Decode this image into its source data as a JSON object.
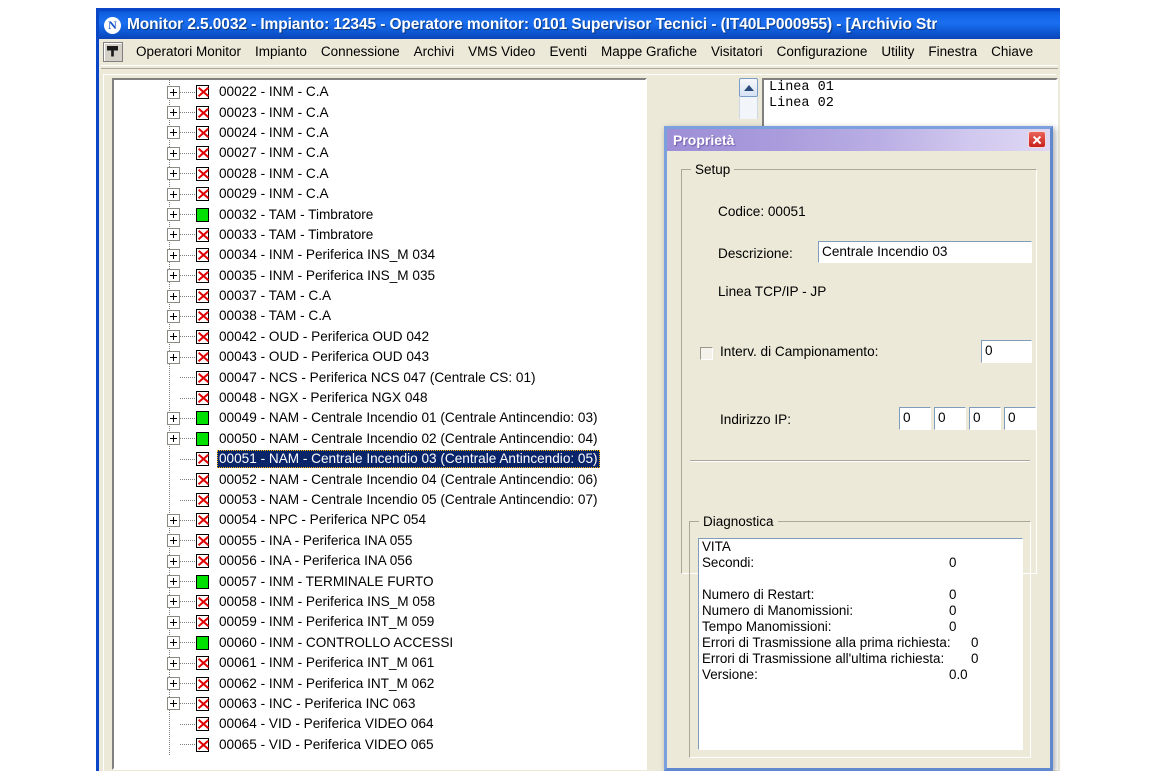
{
  "window": {
    "title": "Monitor 2.5.0032 - Impianto: 12345 - Operatore monitor: 0101 Supervisor Tecnici - (IT40LP000955) - [Archivio Str",
    "title_icon": "N",
    "system_icon_name": "application-system-icon"
  },
  "menu": {
    "items": [
      "Operatori Monitor",
      "Impianto",
      "Connessione",
      "Archivi",
      "VMS Video",
      "Eventi",
      "Mappe Grafiche",
      "Visitatori",
      "Configurazione",
      "Utility",
      "Finestra",
      "Chiave"
    ]
  },
  "tree": {
    "nodes": [
      {
        "expander": true,
        "icon": "error-x-icon",
        "label": "00022 - INM - C.A",
        "selected": false
      },
      {
        "expander": true,
        "icon": "error-x-icon",
        "label": "00023 - INM - C.A",
        "selected": false
      },
      {
        "expander": true,
        "icon": "error-x-icon",
        "label": "00024 - INM - C.A",
        "selected": false
      },
      {
        "expander": true,
        "icon": "error-x-icon",
        "label": "00027 - INM - C.A",
        "selected": false
      },
      {
        "expander": true,
        "icon": "error-x-icon",
        "label": "00028 - INM - C.A",
        "selected": false
      },
      {
        "expander": true,
        "icon": "error-x-icon",
        "label": "00029 - INM - C.A",
        "selected": false
      },
      {
        "expander": true,
        "icon": "ok-green-icon",
        "label": "00032 - TAM - Timbratore",
        "selected": false
      },
      {
        "expander": true,
        "icon": "error-x-icon",
        "label": "00033 - TAM - Timbratore",
        "selected": false
      },
      {
        "expander": true,
        "icon": "error-x-icon",
        "label": "00034 - INM - Periferica INS_M 034",
        "selected": false
      },
      {
        "expander": true,
        "icon": "error-x-icon",
        "label": "00035 - INM - Periferica INS_M 035",
        "selected": false
      },
      {
        "expander": true,
        "icon": "error-x-icon",
        "label": "00037 - TAM - C.A",
        "selected": false
      },
      {
        "expander": true,
        "icon": "error-x-icon",
        "label": "00038 - TAM - C.A",
        "selected": false
      },
      {
        "expander": true,
        "icon": "error-x-icon",
        "label": "00042 - OUD - Periferica OUD 042",
        "selected": false
      },
      {
        "expander": true,
        "icon": "error-x-icon",
        "label": "00043 - OUD - Periferica OUD 043",
        "selected": false
      },
      {
        "expander": false,
        "icon": "error-x-icon",
        "label": "00047 - NCS - Periferica NCS 047 (Centrale CS: 01)",
        "selected": false
      },
      {
        "expander": false,
        "icon": "error-x-icon",
        "label": "00048 - NGX - Periferica NGX 048",
        "selected": false
      },
      {
        "expander": true,
        "icon": "ok-green-icon",
        "label": "00049 - NAM - Centrale Incendio 01 (Centrale Antincendio: 03)",
        "selected": false
      },
      {
        "expander": true,
        "icon": "ok-green-icon",
        "label": "00050 - NAM - Centrale Incendio 02 (Centrale Antincendio: 04)",
        "selected": false
      },
      {
        "expander": false,
        "icon": "error-x-icon",
        "label": "00051 - NAM - Centrale Incendio 03 (Centrale Antincendio: 05)",
        "selected": true
      },
      {
        "expander": false,
        "icon": "error-x-icon",
        "label": "00052 - NAM - Centrale Incendio 04 (Centrale Antincendio: 06)",
        "selected": false
      },
      {
        "expander": false,
        "icon": "error-x-icon",
        "label": "00053 - NAM - Centrale Incendio 05 (Centrale Antincendio: 07)",
        "selected": false
      },
      {
        "expander": true,
        "icon": "error-x-icon",
        "label": "00054 - NPC - Periferica NPC 054",
        "selected": false
      },
      {
        "expander": true,
        "icon": "error-x-icon",
        "label": "00055 - INA - Periferica INA 055",
        "selected": false
      },
      {
        "expander": true,
        "icon": "error-x-icon",
        "label": "00056 - INA - Periferica INA 056",
        "selected": false
      },
      {
        "expander": true,
        "icon": "ok-green-icon",
        "label": "00057 - INM - TERMINALE FURTO",
        "selected": false
      },
      {
        "expander": true,
        "icon": "error-x-icon",
        "label": "00058 - INM - Periferica INS_M 058",
        "selected": false
      },
      {
        "expander": true,
        "icon": "error-x-icon",
        "label": "00059 - INM - Periferica INT_M 059",
        "selected": false
      },
      {
        "expander": true,
        "icon": "ok-green-icon",
        "label": "00060 - INM - CONTROLLO ACCESSI",
        "selected": false
      },
      {
        "expander": true,
        "icon": "error-x-icon",
        "label": "00061 - INM - Periferica INT_M 061",
        "selected": false
      },
      {
        "expander": true,
        "icon": "error-x-icon",
        "label": "00062 - INM - Periferica INT_M 062",
        "selected": false
      },
      {
        "expander": true,
        "icon": "error-x-icon",
        "label": "00063 - INC - Periferica INC 063",
        "selected": false
      },
      {
        "expander": false,
        "icon": "error-x-icon",
        "label": "00064 - VID - Periferica VIDEO 064",
        "selected": false
      },
      {
        "expander": false,
        "icon": "error-x-icon",
        "label": "00065 - VID - Periferica VIDEO 065",
        "selected": false
      }
    ]
  },
  "lines_panel": {
    "lines": [
      "Linea 01",
      "Linea 02"
    ]
  },
  "dialog": {
    "title": "Proprietà",
    "close_label": "x",
    "setup": {
      "legend": "Setup",
      "codice_label": "Codice: 00051",
      "descrizione_label": "Descrizione:",
      "descrizione_value": "Centrale Incendio 03",
      "linea_label": "Linea TCP/IP - JP",
      "interv_label": "Interv. di Campionamento:",
      "interv_value": "0",
      "interv_checked": false,
      "ip_label": "Indirizzo IP:",
      "ip_octets": [
        "0",
        "0",
        "0",
        "0"
      ]
    },
    "diagnostica": {
      "legend": "Diagnostica",
      "rows": [
        {
          "label": "VITA",
          "value": ""
        },
        {
          "label": "Secondi:",
          "value": "0"
        },
        {
          "label": "",
          "value": ""
        },
        {
          "label": "Numero di Restart:",
          "value": "0"
        },
        {
          "label": "Numero di Manomissioni:",
          "value": "0"
        },
        {
          "label": "Tempo Manomissioni:",
          "value": "0"
        },
        {
          "label": "Errori di Trasmissione alla prima richiesta:",
          "value": "0"
        },
        {
          "label": "Errori di Trasmissione all'ultima richiesta:",
          "value": "0"
        },
        {
          "label": "Versione:",
          "value": "0.0"
        }
      ]
    }
  },
  "colors": {
    "titlebar_blue": "#1466e8",
    "dialog_title_purple": "#a99bdc",
    "selection_blue": "#0a246a",
    "status_ok_green": "#00e000",
    "status_error_red": "#e00000",
    "window_face": "#ece9d8"
  }
}
